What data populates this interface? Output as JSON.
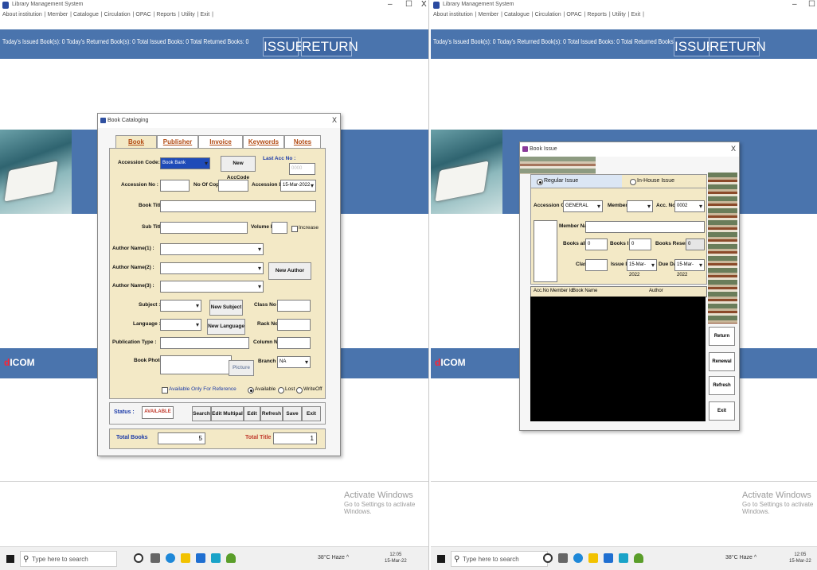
{
  "left": {
    "window_title": "Library Management System",
    "window_controls": [
      "–",
      "☐",
      "X"
    ],
    "menu": [
      "About institution",
      "Member",
      "Catalogue",
      "Circulation",
      "OPAC",
      "Reports",
      "Utility",
      "Exit"
    ],
    "stats": "Today's Issued Book(s): 0    Today's Returned Book(s): 0    Total Issued Books: 0    Total Returned Books: 0",
    "issue_label": "ISSUE",
    "return_label": "RETURN",
    "brand_d": "d",
    "brand_rest": "ICOM",
    "activate_title": "Activate Windows",
    "activate_sub": "Go to Settings to activate Windows.",
    "search_placeholder": "Type here to search",
    "tray": "38°C  Haze  ^",
    "clock_time": "12:05",
    "clock_date": "15-Mar-22",
    "dialog": {
      "title": "Book Cataloging",
      "close": "X",
      "tabs": [
        "Book",
        "Publisher",
        "Invoice Details",
        "Keywords",
        "Notes"
      ],
      "accession_code_label": "Accession Code:",
      "accession_code_value": "Book Bank",
      "new_acccode_btn": "New AccCode",
      "last_acc_label": "Last Acc No :",
      "last_acc_value": "0000",
      "accession_no_label": "Accession No :",
      "no_of_copies_label": "No Of Copies :",
      "accession_date_label": "Accession Date :",
      "accession_date_value": "15-Mar-2022",
      "book_title_label": "Book Title :",
      "sub_title_label": "Sub Title :",
      "volume_no_label": "Volume No :",
      "increase_label": "Increase",
      "author1_label": "Author Name(1) :",
      "author2_label": "Author Name(2) :",
      "author3_label": "Author Name(3) :",
      "new_author_btn": "New Author",
      "subject_label": "Subject :",
      "new_subject_btn": "New Subject",
      "class_no_label": "Class No :",
      "language_label": "Language :",
      "new_language_btn": "New Language",
      "rack_no_label": "Rack No :",
      "publication_type_label": "Publication Type :",
      "column_no_label": "Column No :",
      "book_photo_label": "Book Photo",
      "picture_btn": "Picture",
      "branch_label": "Branch :",
      "branch_value": "NA",
      "ref_only_label": "Available Only For Reference",
      "available_label": "Available",
      "lost_label": "Lost",
      "writeoff_label": "WriteOff",
      "status_label": "Status :",
      "status_value": "AVAILABLE",
      "actions": [
        "Search",
        "Edit Multipal",
        "Edit",
        "Refresh",
        "Save",
        "Exit"
      ],
      "total_books_label": "Total Books",
      "total_books_value": "5",
      "total_title_label": "Total Title",
      "total_title_value": "1"
    }
  },
  "right": {
    "window_title": "Library Management System",
    "window_controls": [
      "–",
      "☐"
    ],
    "menu": [
      "About institution",
      "Member",
      "Catalogue",
      "Circulation",
      "OPAC",
      "Reports",
      "Utility",
      "Exit"
    ],
    "stats": "Today's Issued Book(s): 0    Today's Returned Book(s): 0    Total Issued Books: 0    Total Returned Books: 0",
    "issue_label": "ISSUE",
    "return_label": "RETURN",
    "brand_d": "d",
    "brand_rest": "ICOM",
    "activate_title": "Activate Windows",
    "activate_sub": "Go to Settings to activate Windows.",
    "search_placeholder": "Type here to search",
    "tray": "38°C  Haze  ^",
    "clock_time": "12:05",
    "clock_date": "15-Mar-22",
    "dialog": {
      "title": "Book Issue",
      "close": "X",
      "regular_issue_label": "Regular Issue",
      "inhouse_issue_label": "In-House Issue",
      "accession_code_label": "Accession Code",
      "accession_code_value": "GENERAL",
      "member_id_label": "Member ID",
      "acc_no_label": "Acc. No.",
      "acc_no_value": "0002",
      "member_name_label": "Member Name",
      "books_allowed_label": "Books allowed",
      "books_allowed_value": "0",
      "books_issued_label": "Books Issued",
      "books_issued_value": "0",
      "books_reserved_label": "Books Reserved",
      "books_reserved_value": "0",
      "class_label": "Class",
      "issue_date_label": "Issue Date",
      "issue_date_value": "15-Mar-2022",
      "due_date_label": "Due Date",
      "due_date_value": "15-Mar-2022",
      "grid_headers": [
        "Acc.No",
        "Member Id",
        "Book Name",
        "Author"
      ],
      "side_buttons": [
        "Return",
        "Renewal",
        "Refresh",
        "Exit"
      ]
    }
  }
}
